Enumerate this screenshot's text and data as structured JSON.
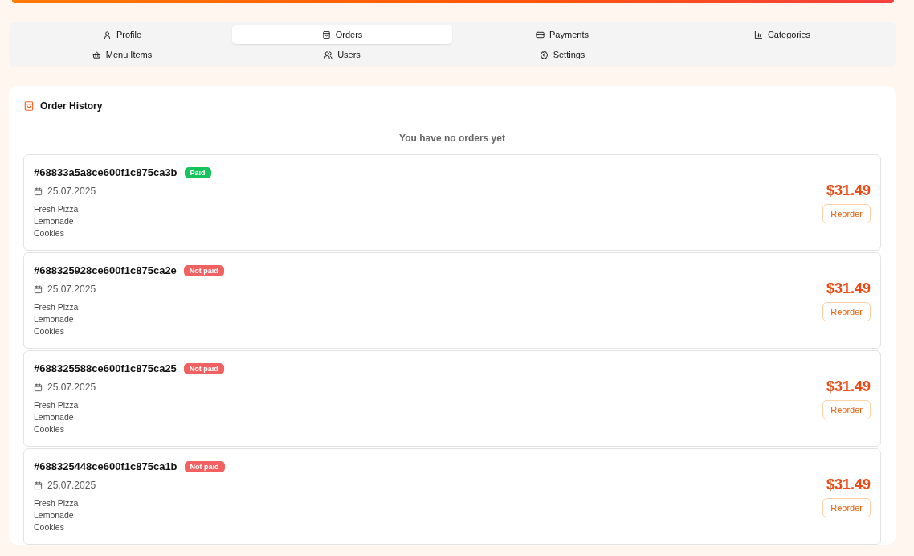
{
  "tabs": [
    {
      "label": "Profile",
      "kind": "user",
      "selected": false
    },
    {
      "label": "Orders",
      "kind": "bag",
      "selected": true
    },
    {
      "label": "Payments",
      "kind": "card",
      "selected": false
    },
    {
      "label": "Categories",
      "kind": "chart",
      "selected": false
    },
    {
      "label": "Menu Items",
      "kind": "basket",
      "selected": false
    },
    {
      "label": "Users",
      "kind": "users",
      "selected": false
    },
    {
      "label": "Settings",
      "kind": "gear",
      "selected": false
    }
  ],
  "order_history": {
    "title": "Order History",
    "empty_message": "You have no orders yet",
    "orders": [
      {
        "id": "#68833a5a8ce600f1c875ca3b",
        "paid": true,
        "status": "Paid",
        "date": "25.07.2025",
        "items": [
          "Fresh Pizza",
          "Lemonade",
          "Cookies"
        ],
        "total": "$31.49",
        "action": "Reorder"
      },
      {
        "id": "#688325928ce600f1c875ca2e",
        "paid": false,
        "status": "Not paid",
        "date": "25.07.2025",
        "items": [
          "Fresh Pizza",
          "Lemonade",
          "Cookies"
        ],
        "total": "$31.49",
        "action": "Reorder"
      },
      {
        "id": "#688325588ce600f1c875ca25",
        "paid": false,
        "status": "Not paid",
        "date": "25.07.2025",
        "items": [
          "Fresh Pizza",
          "Lemonade",
          "Cookies"
        ],
        "total": "$31.49",
        "action": "Reorder"
      },
      {
        "id": "#688325448ce600f1c875ca1b",
        "paid": false,
        "status": "Not paid",
        "date": "25.07.2025",
        "items": [
          "Fresh Pizza",
          "Lemonade",
          "Cookies"
        ],
        "total": "$31.49",
        "action": "Reorder"
      }
    ]
  }
}
